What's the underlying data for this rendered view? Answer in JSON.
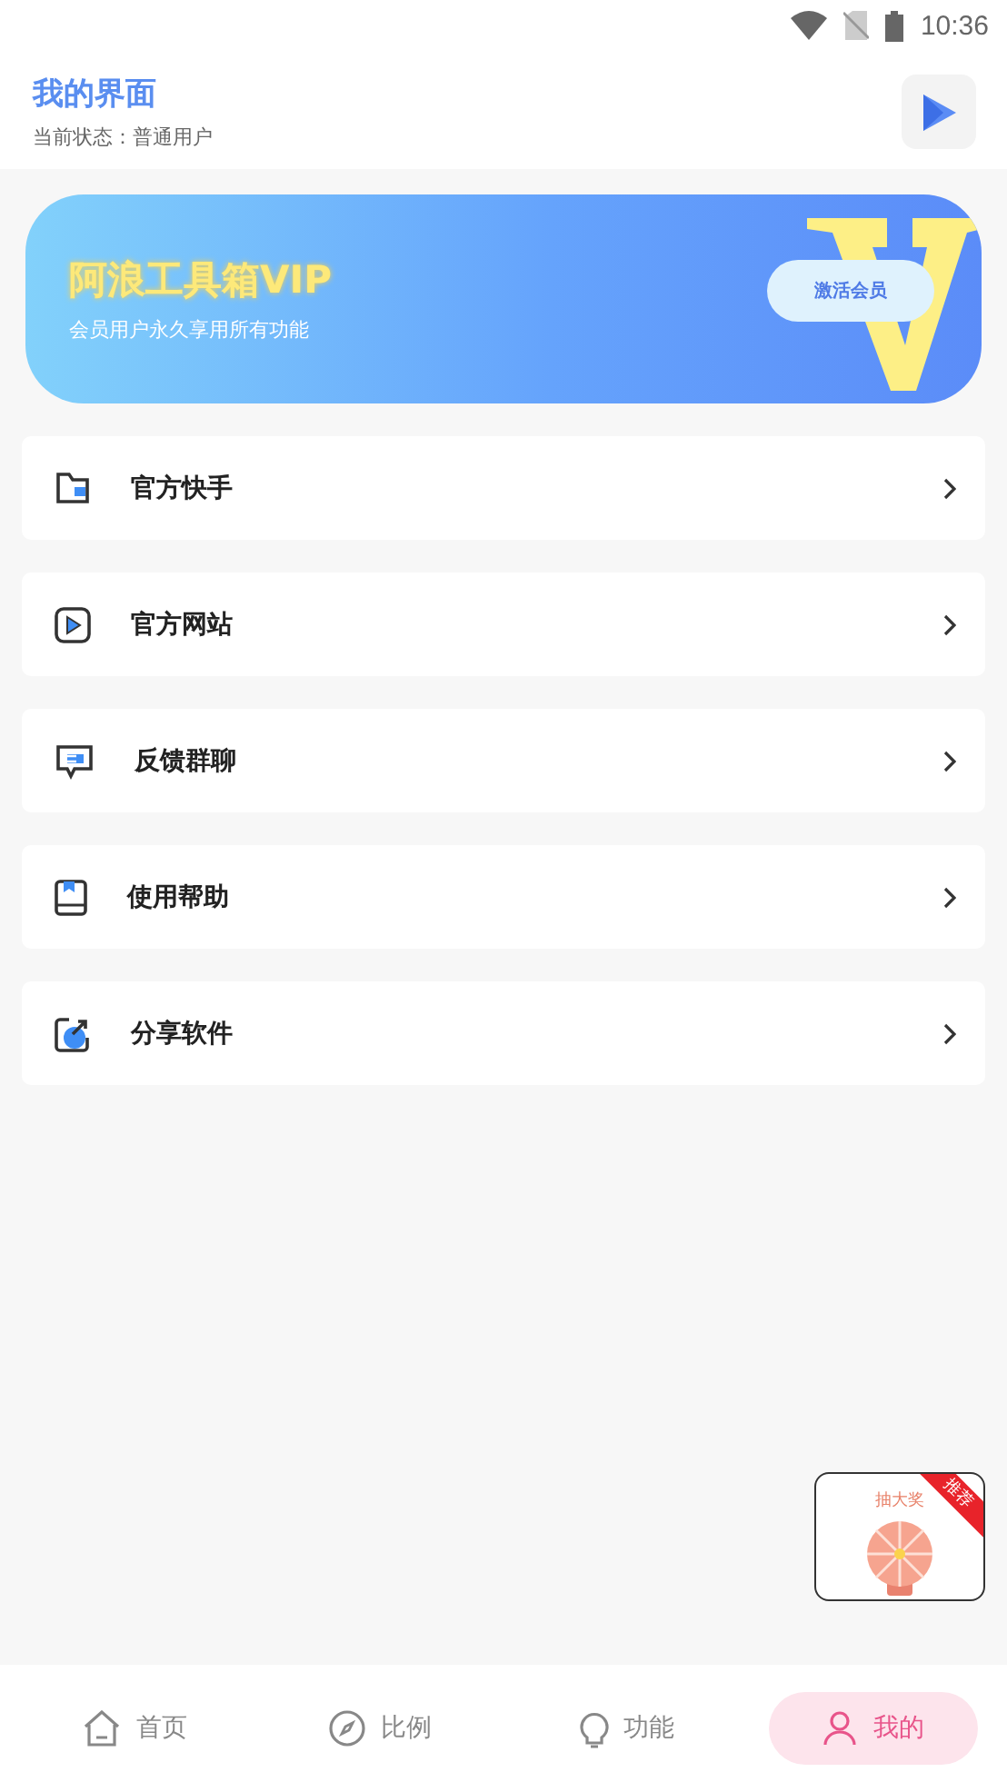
{
  "status_bar": {
    "time": "10:36"
  },
  "header": {
    "title": "我的界面",
    "subtitle": "当前状态：普通用户"
  },
  "vip_banner": {
    "title": "阿浪工具箱VIP",
    "subtitle": "会员用户永久享用所有功能",
    "button": "激活会员"
  },
  "menu": [
    {
      "label": "官方快手",
      "kind": "folder"
    },
    {
      "label": "官方网站",
      "kind": "play"
    },
    {
      "label": "反馈群聊",
      "kind": "chat"
    },
    {
      "label": "使用帮助",
      "kind": "book"
    },
    {
      "label": "分享软件",
      "kind": "share"
    }
  ],
  "floating_ad": {
    "title": "抽大奖",
    "badge": "推荐"
  },
  "tabs": [
    {
      "label": "首页",
      "kind": "home",
      "selected": false
    },
    {
      "label": "比例",
      "kind": "compass",
      "selected": false
    },
    {
      "label": "功能",
      "kind": "bulb",
      "selected": false
    },
    {
      "label": "我的",
      "kind": "user",
      "selected": true
    }
  ]
}
